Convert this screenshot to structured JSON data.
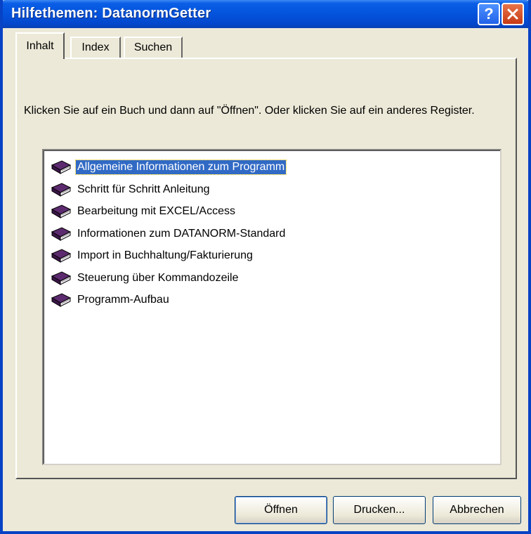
{
  "window": {
    "title": "Hilfethemen: DatanormGetter",
    "help_symbol": "?"
  },
  "tabs": [
    {
      "label": "Inhalt",
      "active": true
    },
    {
      "label": "Index",
      "active": false
    },
    {
      "label": "Suchen",
      "active": false
    }
  ],
  "instruction": "Klicken Sie auf ein Buch und dann auf \"Öffnen\". Oder klicken Sie auf ein anderes Register.",
  "topics": [
    {
      "label": "Allgemeine Informationen zum Programm",
      "icon": "book-icon",
      "selected": true
    },
    {
      "label": "Schritt für Schritt Anleitung",
      "icon": "book-icon",
      "selected": false
    },
    {
      "label": "Bearbeitung mit EXCEL/Access",
      "icon": "book-icon",
      "selected": false
    },
    {
      "label": "Informationen zum DATANORM-Standard",
      "icon": "book-icon",
      "selected": false
    },
    {
      "label": "Import in Buchhaltung/Fakturierung",
      "icon": "book-icon",
      "selected": false
    },
    {
      "label": "Steuerung über Kommandozeile",
      "icon": "book-icon",
      "selected": false
    },
    {
      "label": "Programm-Aufbau",
      "icon": "book-icon",
      "selected": false
    }
  ],
  "buttons": {
    "open": "Öffnen",
    "print": "Drucken...",
    "cancel": "Abbrechen"
  },
  "colors": {
    "titlebar": "#0453dc",
    "selection": "#316ac5",
    "book": "#5c2a6e"
  }
}
